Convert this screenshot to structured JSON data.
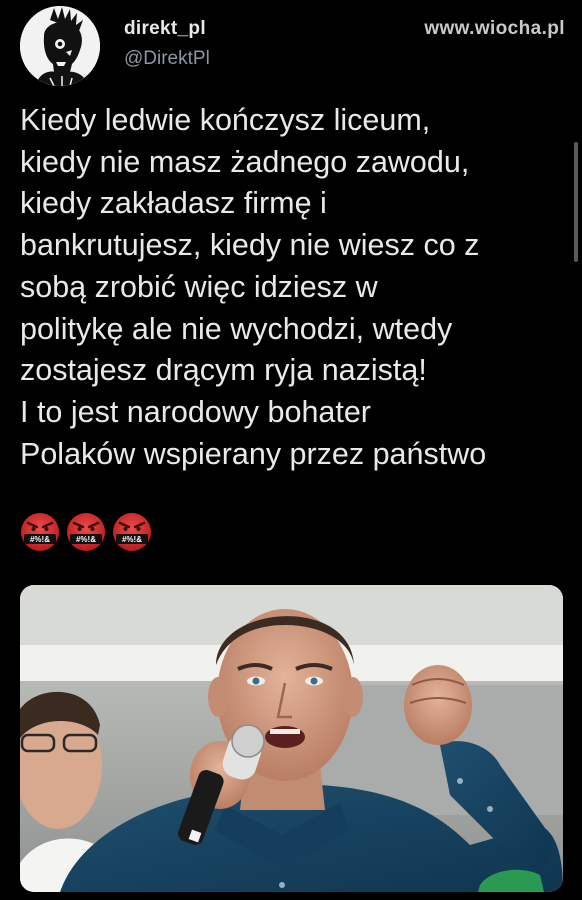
{
  "tweet": {
    "display_name": "direkt_pl",
    "handle": "@DirektPl",
    "text": "Kiedy ledwie kończysz liceum,\nkiedy nie masz żadnego zawodu,\nkiedy zakładasz firmę i\nbankrutujesz, kiedy nie wiesz co z\nsobą zrobić więc idziesz w\npolitykę ale nie wychodzi, wtedy\nzostajesz drącym ryja nazistą!\nI to jest narodowy bohater\nPolaków wspierany przez państwo",
    "emojis": [
      {
        "icon": "face-with-symbols-on-mouth-icon",
        "symbol_text": "#%!&"
      },
      {
        "icon": "face-with-symbols-on-mouth-icon",
        "symbol_text": "#%!&"
      },
      {
        "icon": "face-with-symbols-on-mouth-icon",
        "symbol_text": "#%!&"
      }
    ]
  },
  "watermark": "www.wiocha.pl",
  "colors": {
    "background": "#000000",
    "text_primary": "#e7e9ea",
    "text_secondary": "#8b98a5",
    "emoji_red": "#d32f2f"
  }
}
